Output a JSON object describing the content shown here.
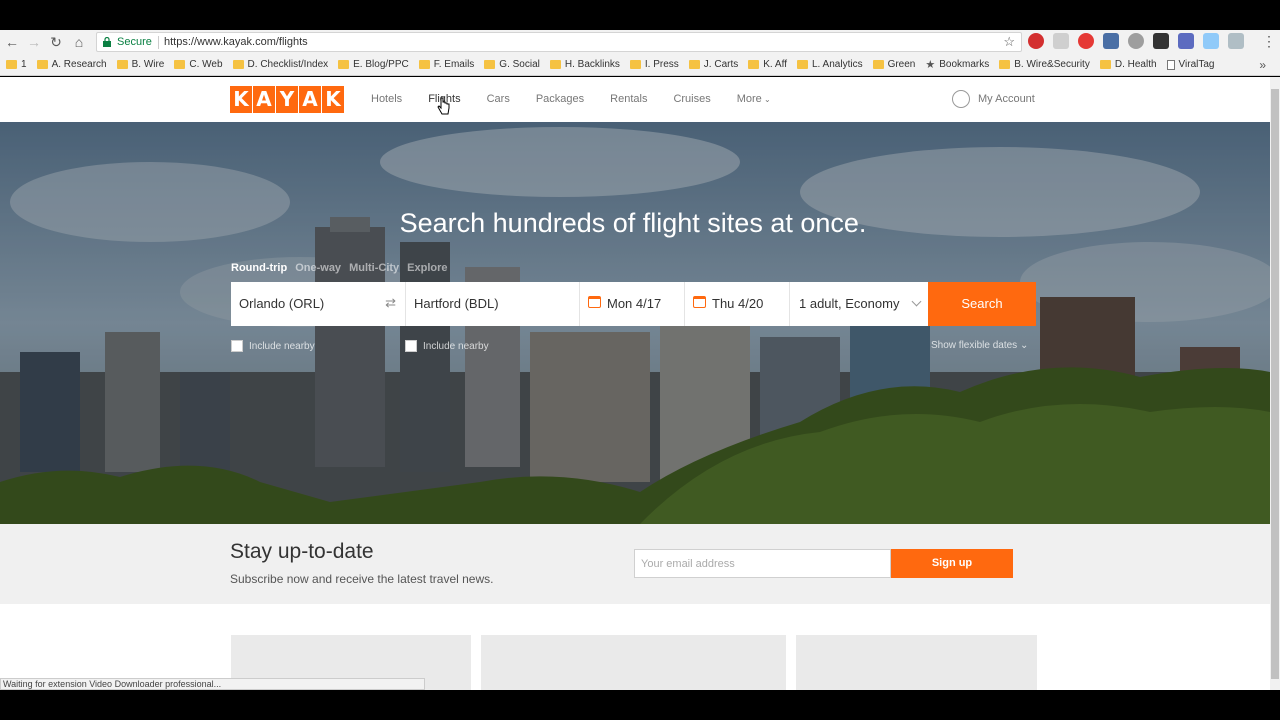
{
  "browser": {
    "secure_label": "Secure",
    "url": "https://www.kayak.com/flights",
    "bookmarks": [
      "1",
      "A. Research",
      "B. Wire",
      "C. Web",
      "D. Checklist/Index",
      "E. Blog/PPC",
      "F. Emails",
      "G. Social",
      "H. Backlinks",
      "I. Press",
      "J. Carts",
      "K. Aff",
      "L. Analytics",
      "Green",
      "Bookmarks",
      "B. Wire&Security",
      "D. Health",
      "ViralTag"
    ],
    "status_text": "Waiting for extension Video Downloader professional..."
  },
  "site": {
    "logo_letters": [
      "K",
      "A",
      "Y",
      "A",
      "K"
    ],
    "nav": [
      "Hotels",
      "Flights",
      "Cars",
      "Packages",
      "Rentals",
      "Cruises",
      "More"
    ],
    "account_label": "My Account"
  },
  "hero": {
    "title": "Search hundreds of flight sites at once.",
    "trip_types": [
      "Round-trip",
      "One-way",
      "Multi-City",
      "Explore"
    ],
    "origin": "Orlando (ORL)",
    "destination": "Hartford (BDL)",
    "depart_date": "Mon 4/17",
    "return_date": "Thu 4/20",
    "travelers": "1 adult, Economy",
    "search_label": "Search",
    "include_nearby": "Include nearby",
    "flexible_dates": "Show flexible dates"
  },
  "newsletter": {
    "title": "Stay up-to-date",
    "subtitle": "Subscribe now and receive the latest travel news.",
    "email_placeholder": "Your email address",
    "signup_label": "Sign up"
  }
}
